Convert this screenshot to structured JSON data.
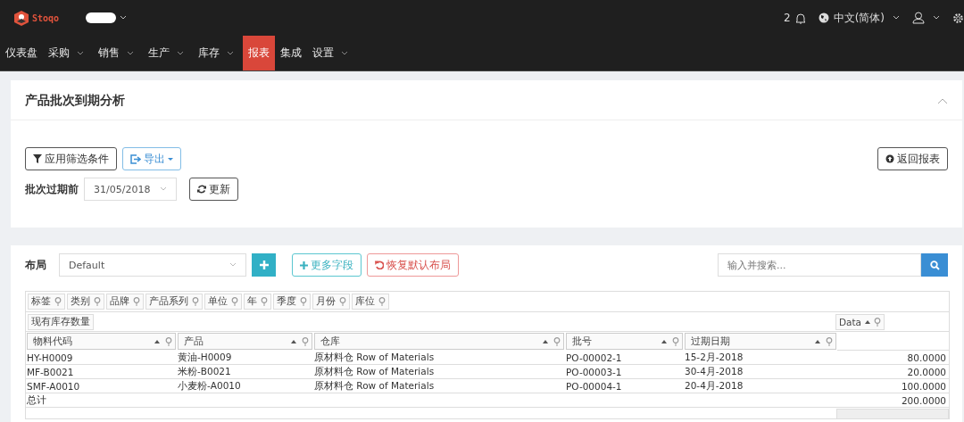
{
  "header": {
    "brand": "Stoqo",
    "notifications": "2",
    "language": "中文(简体)"
  },
  "nav": [
    {
      "label": "仪表盘",
      "dropdown": false,
      "selected": false
    },
    {
      "label": "采购",
      "dropdown": true,
      "selected": false
    },
    {
      "label": "销售",
      "dropdown": true,
      "selected": false
    },
    {
      "label": "生产",
      "dropdown": true,
      "selected": false
    },
    {
      "label": "库存",
      "dropdown": true,
      "selected": false
    },
    {
      "label": "报表",
      "dropdown": false,
      "selected": true
    },
    {
      "label": "集成",
      "dropdown": false,
      "selected": false
    },
    {
      "label": "设置",
      "dropdown": true,
      "selected": false
    }
  ],
  "report": {
    "title": "产品批次到期分析",
    "apply_filter": "应用筛选条件",
    "export": "导出",
    "back": "返回报表",
    "filter_label": "批次过期前",
    "date": "31/05/2018",
    "refresh": "更新"
  },
  "layout": {
    "label": "布局",
    "value": "Default",
    "more_fields": "更多字段",
    "reset": "恢复默认布局",
    "search_placeholder": "输入并搜索..."
  },
  "pivot": {
    "filter_fields": [
      "标签",
      "类别",
      "品牌",
      "产品系列",
      "单位",
      "年",
      "季度",
      "月份",
      "库位"
    ],
    "value_fields": [
      "现有库存数量"
    ],
    "data_field": "Data",
    "columns": [
      "物料代码",
      "产品",
      "仓库",
      "批号",
      "过期日期"
    ],
    "rows": [
      [
        "HY-H0009",
        "黄油-H0009",
        "原材料仓 Row of Materials",
        "PO-00002-1",
        "15-2月-2018",
        "80.0000"
      ],
      [
        "MF-B0021",
        "米粉-B0021",
        "原材料仓 Row of Materials",
        "PO-00003-1",
        "30-4月-2018",
        "20.0000"
      ],
      [
        "SMF-A0010",
        "小麦粉-A0010",
        "原材料仓 Row of Materials",
        "PO-00004-1",
        "20-4月-2018",
        "100.0000"
      ]
    ],
    "total_label": "总计",
    "total": "200.0000"
  }
}
